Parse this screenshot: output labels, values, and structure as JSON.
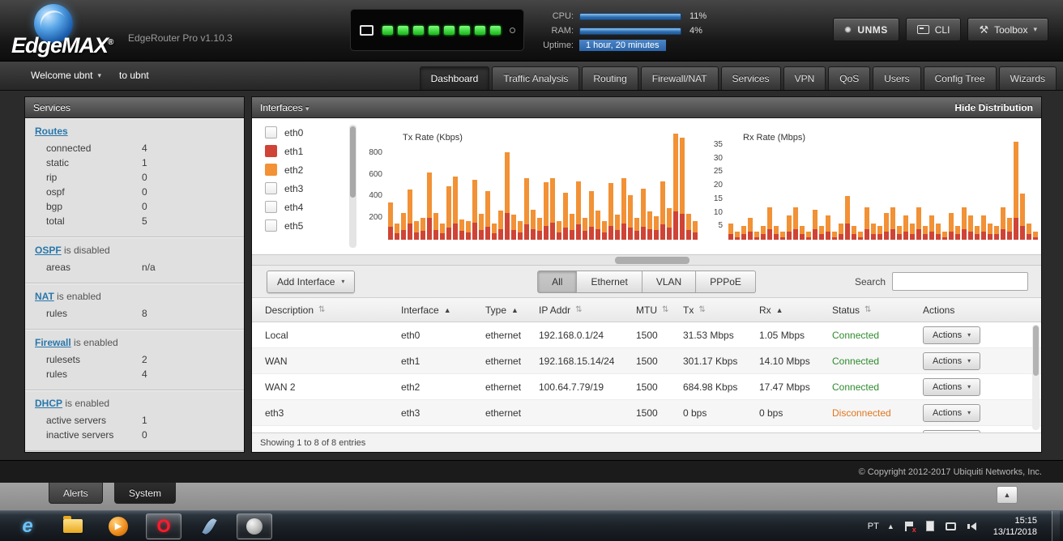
{
  "header": {
    "brand": "EdgeMAX",
    "reg": "®",
    "version": "EdgeRouter Pro v1.10.3",
    "device": {
      "leds_on": 8
    },
    "stats": {
      "cpu_label": "CPU:",
      "cpu_value": "11%",
      "cpu_pct": 11,
      "ram_label": "RAM:",
      "ram_value": "4%",
      "ram_pct": 4,
      "uptime_label": "Uptime:",
      "uptime_value": "1 hour, 20 minutes"
    },
    "buttons": {
      "unms": "UNMS",
      "cli": "CLI",
      "toolbox": "Toolbox"
    }
  },
  "navbar": {
    "welcome": "Welcome ubnt",
    "host": "to ubnt",
    "tabs": [
      {
        "label": "Dashboard",
        "active": true
      },
      {
        "label": "Traffic Analysis",
        "active": false
      },
      {
        "label": "Routing",
        "active": false
      },
      {
        "label": "Firewall/NAT",
        "active": false
      },
      {
        "label": "Services",
        "active": false
      },
      {
        "label": "VPN",
        "active": false
      },
      {
        "label": "QoS",
        "active": false
      },
      {
        "label": "Users",
        "active": false
      },
      {
        "label": "Config Tree",
        "active": false
      },
      {
        "label": "Wizards",
        "active": false
      }
    ]
  },
  "sidebar": {
    "title": "Services",
    "sections": [
      {
        "link": "Routes",
        "suffix": "",
        "rows": [
          [
            "connected",
            "4"
          ],
          [
            "static",
            "1"
          ],
          [
            "rip",
            "0"
          ],
          [
            "ospf",
            "0"
          ],
          [
            "bgp",
            "0"
          ],
          [
            "total",
            "5"
          ]
        ]
      },
      {
        "link": "OSPF",
        "suffix": " is disabled",
        "rows": [
          [
            "areas",
            "n/a"
          ]
        ]
      },
      {
        "link": "NAT",
        "suffix": " is enabled",
        "rows": [
          [
            "rules",
            "8"
          ]
        ]
      },
      {
        "link": "Firewall",
        "suffix": " is enabled",
        "rows": [
          [
            "rulesets",
            "2"
          ],
          [
            "rules",
            "4"
          ]
        ]
      },
      {
        "link": "DHCP",
        "suffix": " is enabled",
        "rows": [
          [
            "active servers",
            "1"
          ],
          [
            "inactive servers",
            "0"
          ]
        ]
      }
    ]
  },
  "interfaces_panel": {
    "title": "Interfaces",
    "hide_distribution": "Hide Distribution",
    "checklist": [
      {
        "label": "eth0",
        "checked": false,
        "color": ""
      },
      {
        "label": "eth1",
        "checked": true,
        "color": "#cf4436"
      },
      {
        "label": "eth2",
        "checked": true,
        "color": "#f29135"
      },
      {
        "label": "eth3",
        "checked": false,
        "color": ""
      },
      {
        "label": "eth4",
        "checked": false,
        "color": ""
      },
      {
        "label": "eth5",
        "checked": false,
        "color": ""
      }
    ]
  },
  "chart_data": [
    {
      "type": "bar",
      "stacked": true,
      "title": "Tx Rate (Kbps)",
      "ylim": [
        0,
        1000
      ],
      "ymax": 1000,
      "yticks": [
        200,
        400,
        600,
        800
      ],
      "series": [
        {
          "name": "eth1",
          "color": "#cf4436",
          "values": [
            120,
            60,
            90,
            150,
            70,
            80,
            200,
            90,
            60,
            110,
            150,
            80,
            70,
            160,
            90,
            120,
            60,
            100,
            250,
            90,
            70,
            140,
            100,
            80,
            130,
            160,
            70,
            110,
            90,
            140,
            80,
            120,
            100,
            70,
            130,
            90,
            150,
            110,
            80,
            120,
            100,
            90,
            140,
            110,
            260,
            240,
            90,
            70
          ]
        },
        {
          "name": "eth2",
          "color": "#f29135",
          "values": [
            220,
            90,
            160,
            310,
            100,
            120,
            420,
            160,
            90,
            380,
            430,
            110,
            100,
            390,
            150,
            330,
            90,
            170,
            560,
            140,
            100,
            430,
            180,
            120,
            400,
            410,
            100,
            320,
            150,
            400,
            120,
            330,
            170,
            100,
            390,
            140,
            420,
            300,
            120,
            350,
            160,
            130,
            400,
            180,
            720,
            700,
            150,
            100
          ]
        }
      ]
    },
    {
      "type": "bar",
      "stacked": true,
      "title": "Rx Rate (Mbps)",
      "ylim": [
        0,
        40
      ],
      "ymax": 40,
      "yticks": [
        5,
        10,
        15,
        20,
        25,
        30,
        35
      ],
      "series": [
        {
          "name": "eth1",
          "color": "#cf4436",
          "values": [
            2,
            1,
            2,
            3,
            1,
            2,
            4,
            2,
            1,
            3,
            4,
            2,
            1,
            4,
            2,
            3,
            1,
            2,
            6,
            2,
            1,
            4,
            2,
            2,
            3,
            4,
            2,
            3,
            2,
            4,
            2,
            3,
            2,
            1,
            3,
            2,
            4,
            3,
            2,
            3,
            2,
            2,
            4,
            3,
            8,
            5,
            2,
            1
          ]
        },
        {
          "name": "eth2",
          "color": "#f29135",
          "values": [
            4,
            2,
            3,
            5,
            2,
            3,
            8,
            3,
            2,
            6,
            8,
            3,
            2,
            7,
            3,
            6,
            2,
            4,
            10,
            3,
            2,
            8,
            4,
            3,
            7,
            8,
            3,
            6,
            4,
            8,
            3,
            6,
            4,
            2,
            7,
            3,
            8,
            6,
            3,
            6,
            4,
            3,
            8,
            5,
            28,
            12,
            4,
            2
          ]
        }
      ]
    }
  ],
  "controls": {
    "add_interface_label": "Add Interface",
    "filters": [
      "All",
      "Ethernet",
      "VLAN",
      "PPPoE"
    ],
    "active_filter": "All",
    "search_label": "Search",
    "search_value": ""
  },
  "table": {
    "columns": [
      {
        "label": "Description",
        "sort": "both"
      },
      {
        "label": "Interface",
        "sort": "asc"
      },
      {
        "label": "Type",
        "sort": "asc"
      },
      {
        "label": "IP Addr",
        "sort": "both"
      },
      {
        "label": "MTU",
        "sort": "both"
      },
      {
        "label": "Tx",
        "sort": "both"
      },
      {
        "label": "Rx",
        "sort": "asc"
      },
      {
        "label": "Status",
        "sort": "both"
      },
      {
        "label": "Actions",
        "sort": "none"
      }
    ],
    "rows": [
      {
        "description": "Local",
        "interface": "eth0",
        "type": "ethernet",
        "ip": "192.168.0.1/24",
        "mtu": "1500",
        "tx": "31.53 Mbps",
        "rx": "1.05 Mbps",
        "status": "Connected"
      },
      {
        "description": "WAN",
        "interface": "eth1",
        "type": "ethernet",
        "ip": "192.168.15.14/24",
        "mtu": "1500",
        "tx": "301.17 Kbps",
        "rx": "14.10 Mbps",
        "status": "Connected"
      },
      {
        "description": "WAN 2",
        "interface": "eth2",
        "type": "ethernet",
        "ip": "100.64.7.79/19",
        "mtu": "1500",
        "tx": "684.98 Kbps",
        "rx": "17.47 Mbps",
        "status": "Connected"
      },
      {
        "description": "eth3",
        "interface": "eth3",
        "type": "ethernet",
        "ip": "",
        "mtu": "1500",
        "tx": "0 bps",
        "rx": "0 bps",
        "status": "Disconnected"
      }
    ],
    "actions_label": "Actions",
    "footer": "Showing 1 to 8 of 8 entries"
  },
  "page_footer": {
    "copyright": "© Copyright 2012-2017 Ubiquiti Networks, Inc."
  },
  "bottom_tabs": {
    "alerts": "Alerts",
    "system": "System"
  },
  "taskbar": {
    "language": "PT",
    "time": "15:15",
    "date": "13/11/2018"
  },
  "colors": {
    "accent_blue": "#2b6cb0",
    "series_red": "#cf4436",
    "series_orange": "#f29135",
    "status_connected": "#2e8b2e",
    "status_disconnected": "#e0761f",
    "link_blue": "#2877ab"
  }
}
